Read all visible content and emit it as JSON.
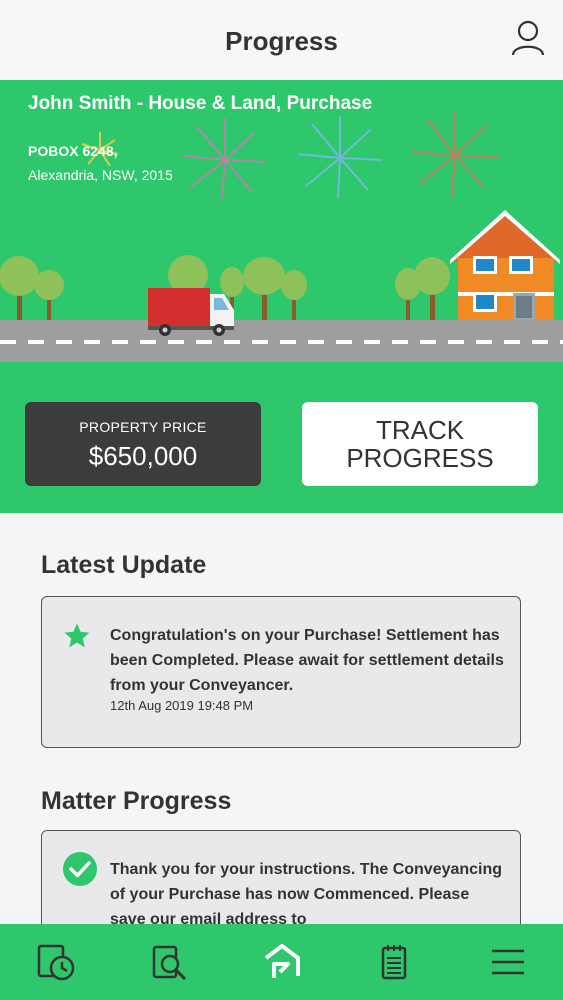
{
  "header": {
    "title": "Progress",
    "profile_icon": "user-icon"
  },
  "hero": {
    "client_line": "John Smith - House & Land, Purchase",
    "address_line1": "POBOX 6248,",
    "address_line2": "Alexandria, NSW, 2015",
    "price_label": "PROPERTY PRICE",
    "price_value": "$650,000",
    "track_line1": "TRACK",
    "track_line2": "PROGRESS"
  },
  "latest_update": {
    "heading": "Latest Update",
    "message": "Congratulation's on your Purchase! Settlement has been Completed. Please await for settlement details from your Conveyancer.",
    "timestamp": "12th Aug 2019 19:48 PM",
    "icon": "star-icon"
  },
  "matter_progress": {
    "heading": "Matter Progress",
    "message": "Thank you for your instructions. The Conveyancing of your Purchase has now Commenced. Please save our email address to",
    "icon": "check-circle-icon"
  },
  "nav": {
    "items": [
      "timeline-icon",
      "search-document-icon",
      "home-icon",
      "notepad-icon",
      "menu-icon"
    ]
  },
  "colors": {
    "green": "#2ec76c",
    "dark": "#3c3c3c",
    "card_bg": "#e9e9eb",
    "truck_red": "#d32f2f",
    "house_orange": "#f08a24"
  }
}
